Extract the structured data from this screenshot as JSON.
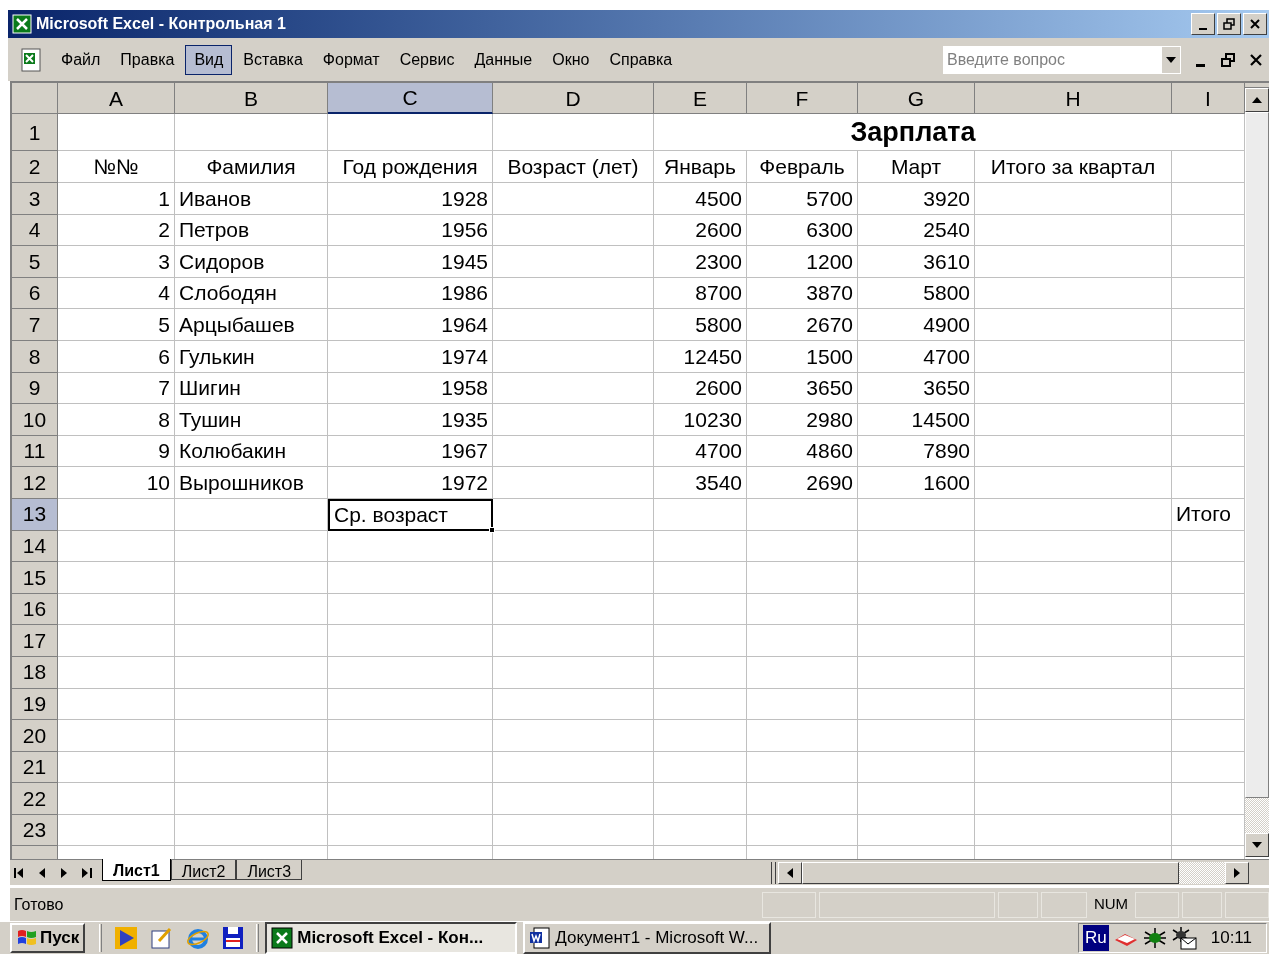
{
  "window": {
    "title": "Microsoft Excel - Контрольная 1"
  },
  "menu": [
    {
      "label": "Файл",
      "selected": false
    },
    {
      "label": "Правка",
      "selected": false
    },
    {
      "label": "Вид",
      "selected": true
    },
    {
      "label": "Вставка",
      "selected": false
    },
    {
      "label": "Формат",
      "selected": false
    },
    {
      "label": "Сервис",
      "selected": false
    },
    {
      "label": "Данные",
      "selected": false
    },
    {
      "label": "Окно",
      "selected": false
    },
    {
      "label": "Справка",
      "selected": false
    }
  ],
  "help_box": {
    "placeholder": "Введите вопрос"
  },
  "columns": [
    {
      "label": "A",
      "selected": false
    },
    {
      "label": "B",
      "selected": false
    },
    {
      "label": "C",
      "selected": true
    },
    {
      "label": "D",
      "selected": false
    },
    {
      "label": "E",
      "selected": false
    },
    {
      "label": "F",
      "selected": false
    },
    {
      "label": "G",
      "selected": false
    },
    {
      "label": "H",
      "selected": false
    },
    {
      "label": "I",
      "selected": false
    }
  ],
  "title_row": {
    "label": "1",
    "selected": false,
    "title": "Зарплата"
  },
  "header_row": {
    "label": "2",
    "selected": false,
    "no": "№№",
    "surname": "Фамилия",
    "birth_year": "Год рождения",
    "age": "Возраст (лет)",
    "jan": "Январь",
    "feb": "Февраль",
    "mar": "Март",
    "quarter_total": "Итого за квартал"
  },
  "data_rows": [
    {
      "label": "3",
      "selected": false,
      "no": "1",
      "surname": "Иванов",
      "birth_year": "1928",
      "jan": "4500",
      "feb": "5700",
      "mar": "3920"
    },
    {
      "label": "4",
      "selected": false,
      "no": "2",
      "surname": "Петров",
      "birth_year": "1956",
      "jan": "2600",
      "feb": "6300",
      "mar": "2540"
    },
    {
      "label": "5",
      "selected": false,
      "no": "3",
      "surname": "Сидоров",
      "birth_year": "1945",
      "jan": "2300",
      "feb": "1200",
      "mar": "3610"
    },
    {
      "label": "6",
      "selected": false,
      "no": "4",
      "surname": "Слободян",
      "birth_year": "1986",
      "jan": "8700",
      "feb": "3870",
      "mar": "5800"
    },
    {
      "label": "7",
      "selected": false,
      "no": "5",
      "surname": "Арцыбашев",
      "birth_year": "1964",
      "jan": "5800",
      "feb": "2670",
      "mar": "4900"
    },
    {
      "label": "8",
      "selected": false,
      "no": "6",
      "surname": "Гулькин",
      "birth_year": "1974",
      "jan": "12450",
      "feb": "1500",
      "mar": "4700"
    },
    {
      "label": "9",
      "selected": false,
      "no": "7",
      "surname": "Шигин",
      "birth_year": "1958",
      "jan": "2600",
      "feb": "3650",
      "mar": "3650"
    },
    {
      "label": "10",
      "selected": false,
      "no": "8",
      "surname": "Тушин",
      "birth_year": "1935",
      "jan": "10230",
      "feb": "2980",
      "mar": "14500"
    },
    {
      "label": "11",
      "selected": false,
      "no": "9",
      "surname": "Колюбакин",
      "birth_year": "1967",
      "jan": "4700",
      "feb": "4860",
      "mar": "7890"
    },
    {
      "label": "12",
      "selected": false,
      "no": "10",
      "surname": "Вырошников",
      "birth_year": "1972",
      "jan": "3540",
      "feb": "2690",
      "mar": "1600"
    }
  ],
  "summary_row": {
    "label": "13",
    "selected": true,
    "avg_label": "Ср. возраст",
    "avg_selected": true,
    "total_label": "Итого"
  },
  "empty_rows": [
    {
      "label": "14",
      "selected": false
    },
    {
      "label": "15",
      "selected": false
    },
    {
      "label": "16",
      "selected": false
    },
    {
      "label": "17",
      "selected": false
    },
    {
      "label": "18",
      "selected": false
    },
    {
      "label": "19",
      "selected": false
    },
    {
      "label": "20",
      "selected": false
    },
    {
      "label": "21",
      "selected": false
    },
    {
      "label": "22",
      "selected": false
    },
    {
      "label": "23",
      "selected": false
    }
  ],
  "sheet_tabs": [
    {
      "label": "Лист1",
      "selected": true
    },
    {
      "label": "Лист2",
      "selected": false
    },
    {
      "label": "Лист3",
      "selected": false
    }
  ],
  "status_bar": {
    "message": "Готово",
    "indicator": "NUM"
  },
  "taskbar": {
    "start": "Пуск",
    "tasks": [
      {
        "label": "Microsoft Excel - Кон...",
        "selected": true,
        "kind": "excel"
      },
      {
        "label": "Документ1 - Microsoft W...",
        "selected": false,
        "kind": "word"
      }
    ],
    "language": "Ru",
    "clock": "10:11"
  }
}
